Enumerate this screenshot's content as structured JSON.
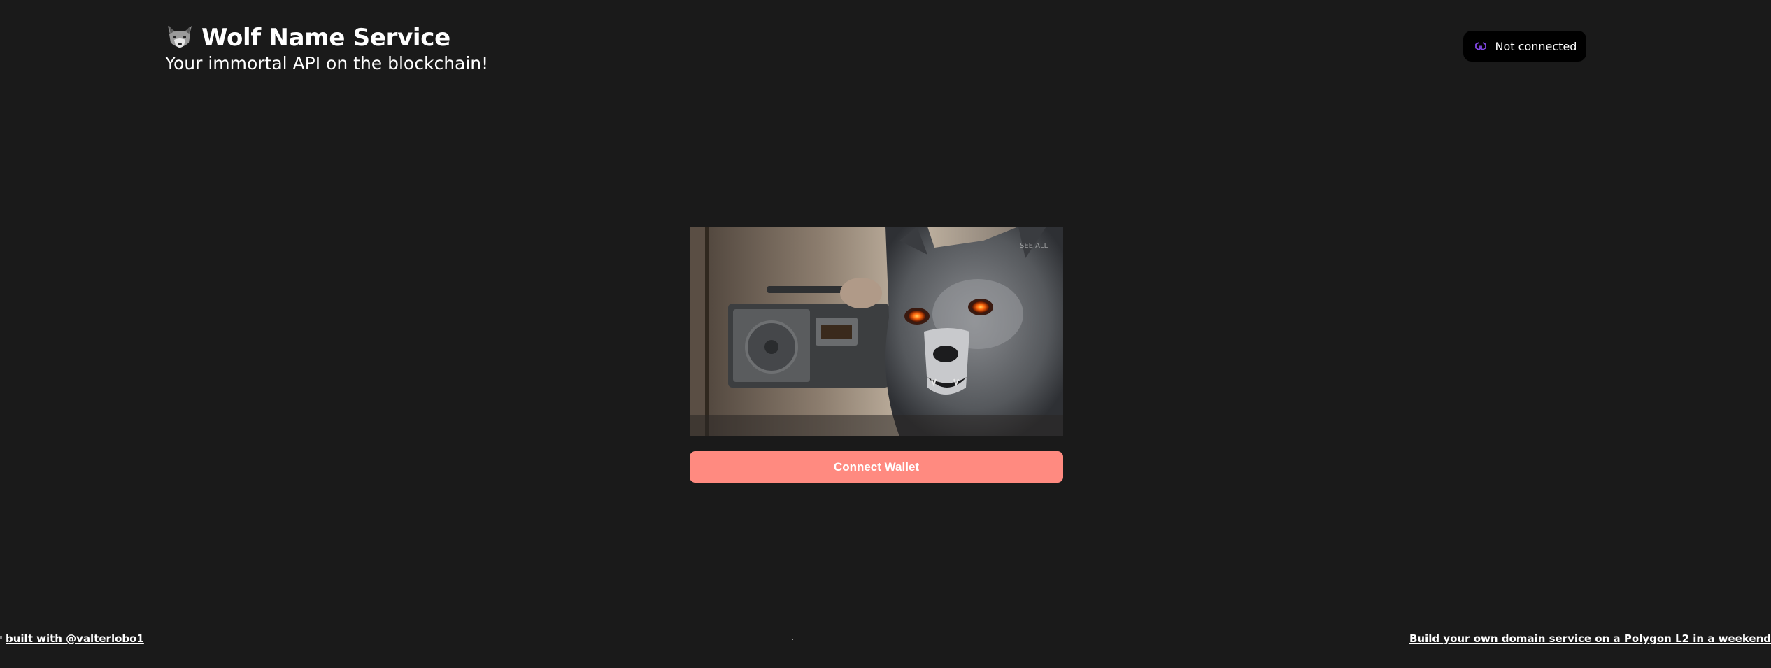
{
  "header": {
    "title": "Wolf Name Service",
    "subtitle": "Your immortal API on the blockchain!",
    "logo_icon": "wolf-face-icon"
  },
  "network": {
    "status": "Not connected",
    "icon": "polygon-icon",
    "icon_color": "#8247e5"
  },
  "hero": {
    "image": "wolf-boombox-image"
  },
  "actions": {
    "connect_label": "Connect Wallet",
    "accent_color": "#ff8a80"
  },
  "footer": {
    "left_link": "built with @valterlobo1",
    "right_link": "Build your own domain service on a Polygon L2 in a weekend"
  }
}
